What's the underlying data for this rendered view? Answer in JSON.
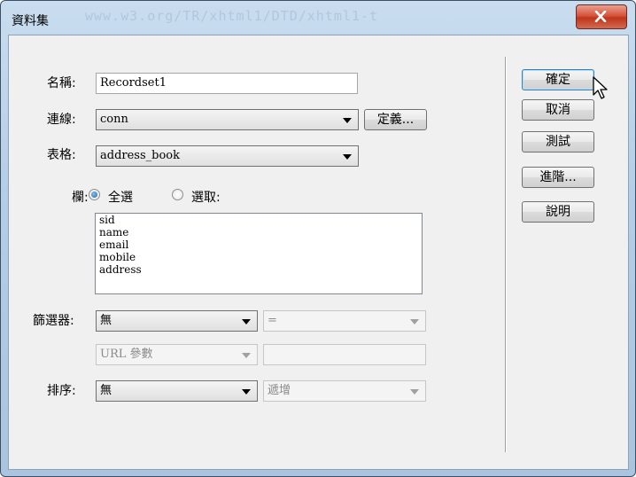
{
  "window": {
    "title": "資料集",
    "ghost_url": "www.w3.org/TR/xhtml1/DTD/xhtml1-t",
    "close_icon": "close-x-icon"
  },
  "form": {
    "name_label": "名稱:",
    "name_value": "Recordset1",
    "connection_label": "連線:",
    "connection_value": "conn",
    "define_button": "定義...",
    "table_label": "表格:",
    "table_value": "address_book",
    "columns_label": "欄:",
    "radio_all": "全選",
    "radio_select": "選取:",
    "columns": [
      "sid",
      "name",
      "email",
      "mobile",
      "address"
    ],
    "filter_label": "篩選器:",
    "filter_value": "無",
    "filter_operator": "=",
    "filter_param": "URL 參數",
    "sort_label": "排序:",
    "sort_value": "無",
    "sort_order": "遞增"
  },
  "buttons": {
    "ok": "確定",
    "cancel": "取消",
    "test": "測試",
    "advanced": "進階...",
    "help": "說明"
  }
}
